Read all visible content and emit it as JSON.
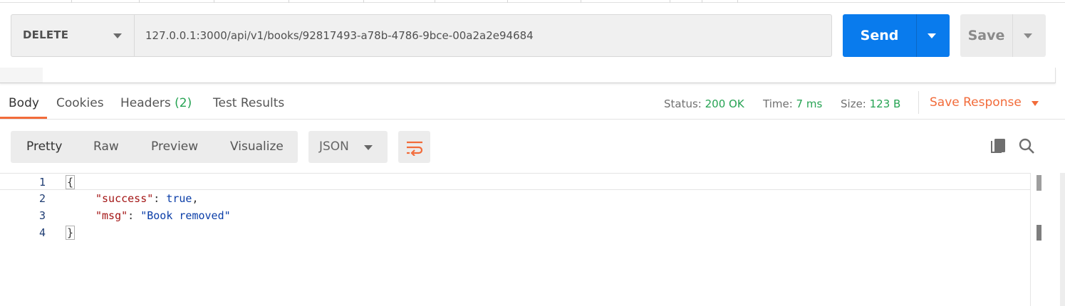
{
  "request": {
    "method": "DELETE",
    "url": "127.0.0.1:3000/api/v1/books/92817493-a78b-4786-9bce-00a2a2e94684",
    "send_label": "Send",
    "save_label": "Save"
  },
  "response_tabs": {
    "body": "Body",
    "cookies": "Cookies",
    "headers": "Headers",
    "headers_count": "(2)",
    "test_results": "Test Results"
  },
  "response_meta": {
    "status_label": "Status:",
    "status_value": "200 OK",
    "time_label": "Time:",
    "time_value": "7 ms",
    "size_label": "Size:",
    "size_value": "123 B",
    "save_response": "Save Response"
  },
  "view_modes": {
    "pretty": "Pretty",
    "raw": "Raw",
    "preview": "Preview",
    "visualize": "Visualize"
  },
  "format": {
    "selected": "JSON"
  },
  "code": {
    "line_numbers": [
      "1",
      "2",
      "3",
      "4"
    ],
    "open_brace": "{",
    "close_brace": "}",
    "line2": {
      "key": "\"success\"",
      "sep": ": ",
      "value": "true",
      "trail": ","
    },
    "line3": {
      "key": "\"msg\"",
      "sep": ": ",
      "value": "\"Book removed\""
    }
  },
  "icons": {
    "wrap": "wrap-lines-icon",
    "copy": "copy-icon",
    "search": "search-icon"
  },
  "colors": {
    "send": "#097bed",
    "accent": "#f26b3a",
    "success": "#26a353"
  }
}
